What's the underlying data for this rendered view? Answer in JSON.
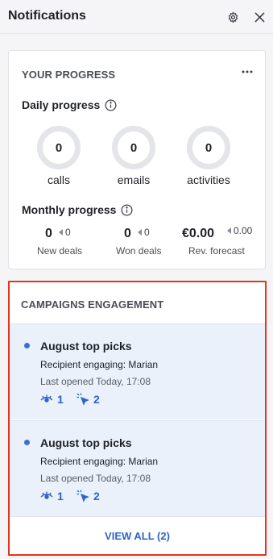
{
  "header": {
    "title": "Notifications",
    "settings_icon": "gear-icon",
    "close_icon": "close-icon"
  },
  "progress": {
    "title": "YOUR PROGRESS",
    "more_icon": "more-horizontal-icon",
    "daily": {
      "title": "Daily progress",
      "info_icon": "info-icon",
      "items": [
        {
          "value": "0",
          "label": "calls"
        },
        {
          "value": "0",
          "label": "emails"
        },
        {
          "value": "0",
          "label": "activities"
        }
      ]
    },
    "monthly": {
      "title": "Monthly progress",
      "info_icon": "info-icon",
      "items": [
        {
          "value": "0",
          "delta": "0",
          "label": "New deals"
        },
        {
          "value": "0",
          "delta": "0",
          "label": "Won deals"
        },
        {
          "value": "€0.00",
          "delta": "0.00",
          "label": "Rev. forecast"
        }
      ]
    }
  },
  "campaigns": {
    "title": "CAMPAIGNS ENGAGEMENT",
    "items": [
      {
        "title": "August top picks",
        "recipient": "Recipient engaging: Marian",
        "last_opened": "Last opened Today, 17:08",
        "opens": "1",
        "clicks": "2"
      },
      {
        "title": "August top picks",
        "recipient": "Recipient engaging: Marian",
        "last_opened": "Last opened Today, 17:08",
        "opens": "1",
        "clicks": "2"
      }
    ],
    "view_all": "VIEW ALL (2)"
  },
  "colors": {
    "accent": "#2f64c9",
    "unread_dot": "#3b6fd6",
    "highlight_frame": "#e5341e",
    "item_background": "#eaf1fb"
  }
}
